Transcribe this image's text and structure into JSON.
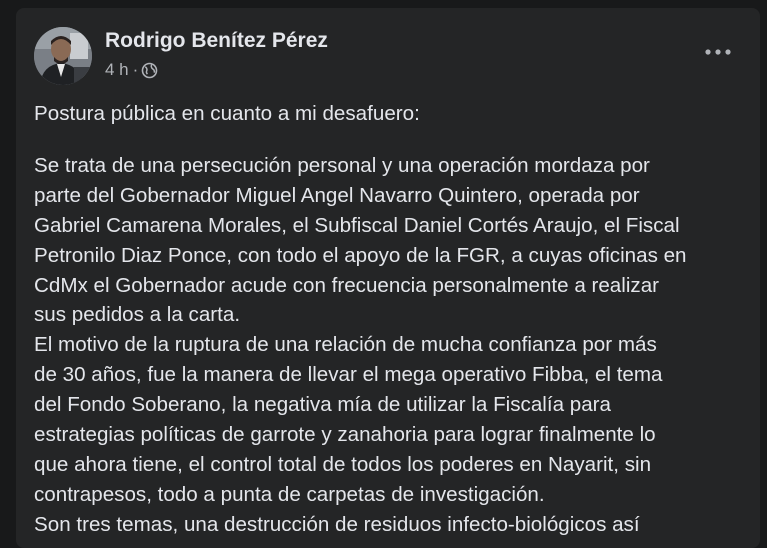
{
  "post": {
    "author": "Rodrigo Benítez Pérez",
    "time": "4 h",
    "separator": "·",
    "privacy_icon": "globe-icon",
    "more_icon": "more-options-icon",
    "intro": "Postura pública en cuanto a mi desafuero:",
    "lines": [
      "Se trata de una persecución personal y una operación mordaza por",
      "parte del Gobernador Miguel Angel Navarro Quintero, operada por",
      "Gabriel Camarena Morales, el Subfiscal Daniel Cortés Araujo, el Fiscal",
      "Petronilo Diaz Ponce, con todo el apoyo de la FGR, a cuyas oficinas en",
      "CdMx el Gobernador acude con frecuencia personalmente a realizar",
      "sus pedidos a la carta.",
      "El motivo de la ruptura de una relación de mucha confianza por más",
      "de 30 años, fue la manera de llevar el mega operativo Fibba, el tema",
      "del Fondo Soberano, la negativa mía de utilizar la Fiscalía para",
      "estrategias políticas de garrote y zanahoria para lograr finalmente lo",
      "que ahora tiene, el control total de todos los poderes en Nayarit, sin",
      "contrapesos, todo a punta de carpetas de investigación.",
      "Son tres temas, una destrucción de residuos infecto-biológicos así"
    ]
  },
  "colors": {
    "page_background": "#18191a",
    "card_background": "#242526",
    "primary_text": "#e4e6eb",
    "secondary_text": "#b0b3b8"
  }
}
